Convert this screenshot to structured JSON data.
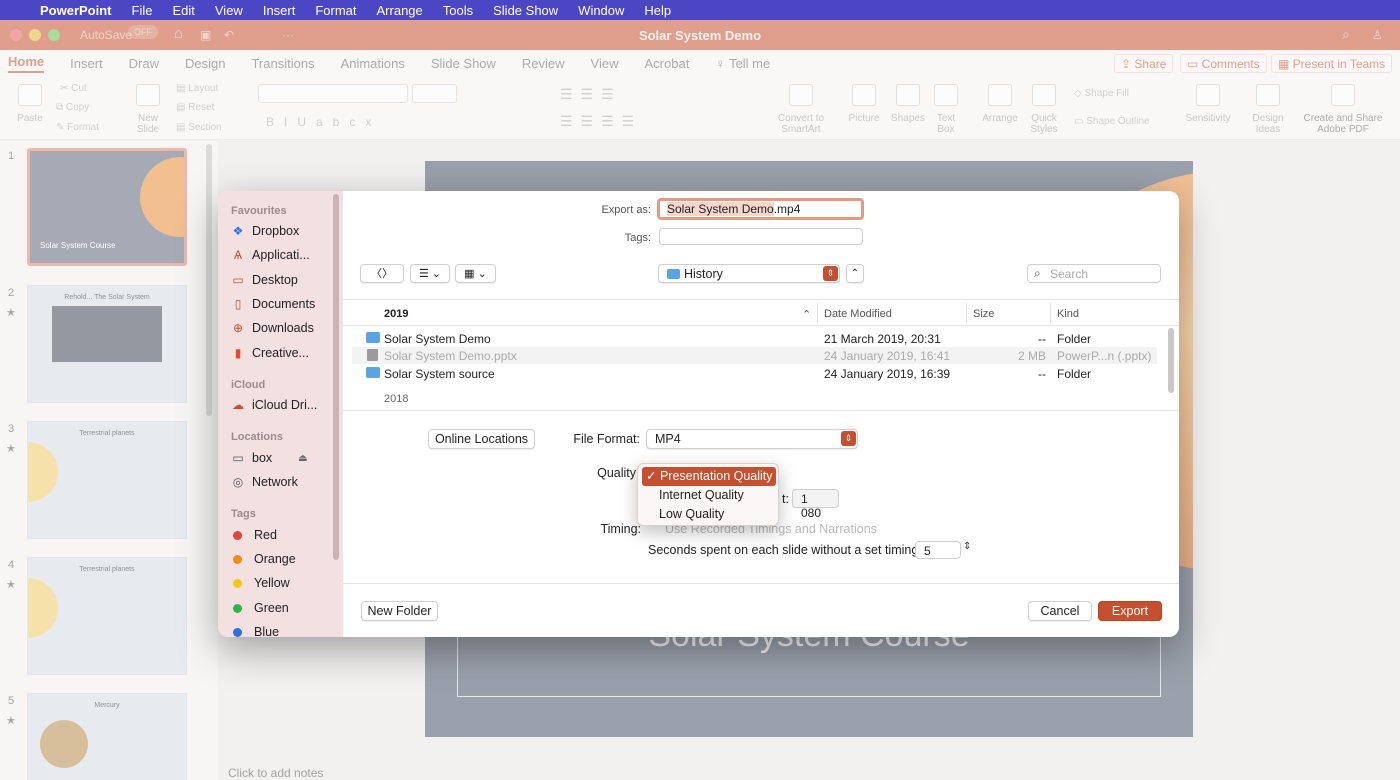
{
  "menubar": {
    "app": "PowerPoint",
    "items": [
      "File",
      "Edit",
      "View",
      "Insert",
      "Format",
      "Arrange",
      "Tools",
      "Slide Show",
      "Window",
      "Help"
    ]
  },
  "titlebar": {
    "autosave": "AutoSave",
    "autosave_state": "OFF",
    "document_title": "Solar System Demo"
  },
  "ribbon_tabs": [
    "Home",
    "Insert",
    "Draw",
    "Design",
    "Transitions",
    "Animations",
    "Slide Show",
    "Review",
    "View",
    "Acrobat"
  ],
  "tell_me": "Tell me",
  "share": "Share",
  "comments": "Comments",
  "present_in_teams": "Present in Teams",
  "ribbon": {
    "paste": "Paste",
    "cut": "Cut",
    "copy": "Copy",
    "format": "Format",
    "new_slide": "New Slide",
    "layout": "Layout",
    "reset": "Reset",
    "section": "Section",
    "convert_to_smartart": "Convert to SmartArt",
    "picture": "Picture",
    "shapes": "Shapes",
    "text_box": "Text Box",
    "arrange": "Arrange",
    "quick_styles": "Quick Styles",
    "shape_fill": "Shape Fill",
    "shape_outline": "Shape Outline",
    "sensitivity": "Sensitivity",
    "design_ideas": "Design Ideas",
    "create_share_pdf": "Create and Share Adobe PDF"
  },
  "slides": [
    {
      "num": "1",
      "title": "Solar System Course"
    },
    {
      "num": "2",
      "title": "Rehold... The Solar System"
    },
    {
      "num": "3",
      "title": "Terrestrial planets"
    },
    {
      "num": "4",
      "title": "Terrestrial planets"
    },
    {
      "num": "5",
      "title": "Mercury"
    }
  ],
  "main_slide": {
    "title": "Solar System Course"
  },
  "notes_placeholder": "Click to add notes",
  "dialog": {
    "export_as_label": "Export as:",
    "export_as_name": "Solar System Demo",
    "export_as_ext": ".mp4",
    "tags_label": "Tags:",
    "location": "History",
    "search_placeholder": "Search",
    "columns": {
      "name": "2019",
      "date": "Date Modified",
      "size": "Size",
      "kind": "Kind"
    },
    "files": [
      {
        "name": "Solar System Demo",
        "date": "21 March 2019, 20:31",
        "size": "--",
        "kind": "Folder"
      },
      {
        "name": "Solar System Demo.pptx",
        "date": "24 January 2019, 16:41",
        "size": "2 MB",
        "kind": "PowerP...n (.pptx)"
      },
      {
        "name": "Solar System source",
        "date": "24 January 2019, 16:39",
        "size": "--",
        "kind": "Folder"
      }
    ],
    "group_2018": "2018",
    "online_locations": "Online Locations",
    "file_format_label": "File Format:",
    "file_format": "MP4",
    "quality_label": "Quality",
    "height_label_tail": "t:",
    "height_value": "1 080",
    "timing_label": "Timing:",
    "timing_option": "Use Recorded Timings and Narrations",
    "seconds_label": "Seconds spent on each slide without a set timing:",
    "seconds_value": "5",
    "new_folder": "New Folder",
    "cancel": "Cancel",
    "export": "Export"
  },
  "sidebar": {
    "favourites": "Favourites",
    "fav_items": [
      "Dropbox",
      "Applicati...",
      "Desktop",
      "Documents",
      "Downloads",
      "Creative..."
    ],
    "icloud": "iCloud",
    "icloud_items": [
      "iCloud Dri..."
    ],
    "locations": "Locations",
    "location_items": [
      "box",
      "Network"
    ],
    "tags": "Tags",
    "tag_items": [
      {
        "label": "Red",
        "color": "#e2433a"
      },
      {
        "label": "Orange",
        "color": "#f28a1e"
      },
      {
        "label": "Yellow",
        "color": "#f5c518"
      },
      {
        "label": "Green",
        "color": "#2fb34a"
      },
      {
        "label": "Blue",
        "color": "#2d6fe0"
      }
    ]
  },
  "quality_menu": {
    "checkmark": "✓",
    "options": [
      "Presentation Quality",
      "Internet Quality",
      "Low Quality"
    ],
    "selected": "Presentation Quality"
  }
}
